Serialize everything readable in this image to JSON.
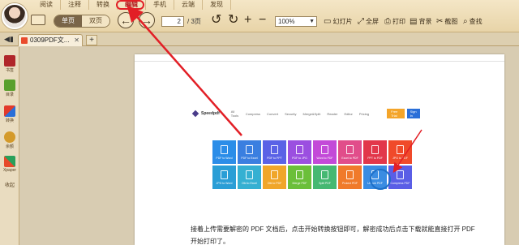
{
  "menu": {
    "tabs": [
      "阅读",
      "注释",
      "转换",
      "编辑",
      "手机",
      "云端",
      "发现"
    ],
    "active": "编辑"
  },
  "toolbar": {
    "view_single": "单页",
    "view_double": "双页",
    "current_page": "2",
    "total_pages": "/ 3页",
    "zoom": "100%",
    "slideshow": "幻灯片",
    "fullscreen": "全屏",
    "print": "打印",
    "background": "背景",
    "screenshot": "截图",
    "find": "查找"
  },
  "tabs": {
    "document": "0309PDF文...",
    "add": "+"
  },
  "sidebar": {
    "items": [
      "书签",
      "目录",
      "转换",
      "余额",
      "Xpaper",
      "收起"
    ]
  },
  "document": {
    "site_logo": "Speedpdf",
    "nav_links": [
      "All Tools",
      "Compress",
      "Convert",
      "Security",
      "Merge&Split",
      "Reader",
      "Editor",
      "Pricing"
    ],
    "try_button": "Free Trial",
    "signin_button": "Sign In",
    "tools_row1": [
      "PDF to Word",
      "PDF to Excel",
      "PDF to PPT",
      "PDF to JPG",
      "Word to PDF",
      "Excel to PDF",
      "PPT to PDF",
      "JPG to PDF"
    ],
    "tools_row2": [
      "JPG to Word",
      "Ofd to Excel",
      "Ofd to PDF",
      "Merge PDF",
      "Split PDF",
      "Protect PDF",
      "Unlock PDF",
      "Compress PDF"
    ],
    "caption": "接着上传需要解密的 PDF 文档后，点击开始转换按钮即可，解密成功后点击下载就能直接打开 PDF 开始打印了。"
  },
  "colors": {
    "accent_red": "#e21f26",
    "row1": [
      "#2b8de8",
      "#3a7fe0",
      "#5a62e6",
      "#9b4fe0",
      "#c34ad8",
      "#e14d8a",
      "#e2374a",
      "#f04a2a"
    ],
    "row2": [
      "#2a9ed6",
      "#35b0d2",
      "#f0a62a",
      "#6bbf3a",
      "#46b872",
      "#f07a2a",
      "#3a8ce2",
      "#5a5ee6"
    ]
  }
}
